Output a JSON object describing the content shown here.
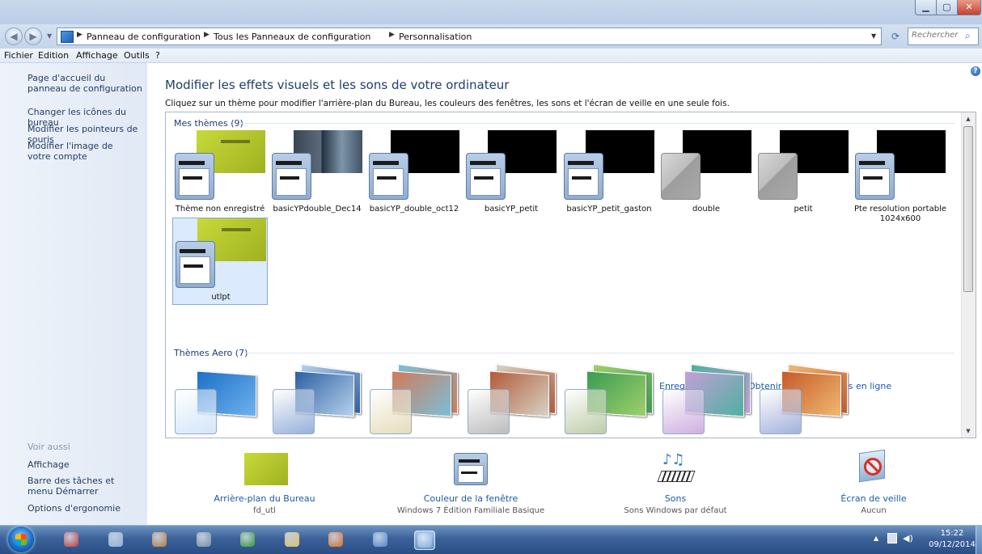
{
  "window": {
    "minimize_icon": "minimize-icon",
    "maximize_icon": "maximize-icon",
    "close_icon": "close-icon",
    "close_glyph": "✕"
  },
  "address": {
    "crumbs": [
      "Panneau de configuration",
      "Tous les Panneaux de configuration",
      "Personnalisation"
    ],
    "search_placeholder": "Rechercher"
  },
  "menu": [
    "Fichier",
    "Edition",
    "Affichage",
    "Outils",
    "?"
  ],
  "sidebar": {
    "links": [
      "Page d'accueil du panneau de configuration",
      "Changer les icônes du bureau",
      "Modifier les pointeurs de souris",
      "Modifier l'image de votre compte"
    ],
    "see_also_label": "Voir aussi",
    "see_also": [
      "Affichage",
      "Barre des tâches et menu Démarrer",
      "Options d'ergonomie"
    ]
  },
  "main": {
    "title": "Modifier les effets visuels et les sons de votre ordinateur",
    "subtitle": "Cliquez sur un thème pour modifier l'arrière-plan du Bureau, les couleurs des fenêtres, les sons et l'écran de veille en une seule fois.",
    "my_themes_header": "Mes thèmes (9)",
    "my_themes": [
      {
        "label": "Thème non enregistré",
        "thumb": "yellow",
        "window": "blue"
      },
      {
        "label": "basicYPdouble_Dec14",
        "thumb": "photo",
        "window": "blue"
      },
      {
        "label": "basicYP_double_oct12",
        "thumb": "black",
        "window": "blue"
      },
      {
        "label": "basicYP_petit",
        "thumb": "black",
        "window": "blue"
      },
      {
        "label": "basicYP_petit_gaston",
        "thumb": "black",
        "window": "blue"
      },
      {
        "label": "double",
        "thumb": "black",
        "window": "gray"
      },
      {
        "label": "petit",
        "thumb": "black",
        "window": "gray"
      },
      {
        "label": "Pte resolution portable 1024x600",
        "thumb": "black",
        "window": "blue"
      },
      {
        "label": "utlpt",
        "thumb": "yellow",
        "window": "blue",
        "selected": true
      }
    ],
    "save_theme_link": "Enregistrer le thème",
    "more_themes_link": "Obtenir plus de thèmes en ligne",
    "aero_header": "Thèmes Aero (7)",
    "aero_themes": [
      {
        "colors": [
          "#1d6fc8",
          "#6fb2ec"
        ],
        "window": "#cfe3f7"
      },
      {
        "colors": [
          "#2c5fa0",
          "#b6d2ee"
        ],
        "window": "#8ba7d6"
      },
      {
        "colors": [
          "#d27a58",
          "#79c0d8"
        ],
        "window": "#e4d9b4"
      },
      {
        "colors": [
          "#b25a38",
          "#d8d2c4"
        ],
        "window": "#b5b5b5"
      },
      {
        "colors": [
          "#3a9b52",
          "#9fd06b"
        ],
        "window": "#b7c7a0"
      },
      {
        "colors": [
          "#c4a0d8",
          "#4db0a0"
        ],
        "window": "#c9a6dd"
      },
      {
        "colors": [
          "#c65a2a",
          "#f0b870"
        ],
        "window": "#9aa8d6"
      }
    ]
  },
  "bottom": [
    {
      "link": "Arrière-plan du Bureau",
      "sub": "fd_utl",
      "icon": "desktop-background-icon"
    },
    {
      "link": "Couleur de la fenêtre",
      "sub": "Windows 7 Édition Familiale Basique",
      "icon": "window-color-icon"
    },
    {
      "link": "Sons",
      "sub": "Sons Windows par défaut",
      "icon": "sounds-icon"
    },
    {
      "link": "Écran de veille",
      "sub": "Aucun",
      "icon": "screensaver-icon"
    }
  ],
  "taskbar": {
    "icons": [
      {
        "name": "snipping-tool-icon",
        "color": "#c83b3b"
      },
      {
        "name": "notepad-icon",
        "color": "#8fb1d8"
      },
      {
        "name": "games-icon",
        "color": "#b87c3a"
      },
      {
        "name": "calculator-icon",
        "color": "#7a8fa6"
      },
      {
        "name": "xbox-icon",
        "color": "#2f9a2f"
      },
      {
        "name": "explorer-icon",
        "color": "#e8c35a"
      },
      {
        "name": "firefox-icon",
        "color": "#e36b1c"
      },
      {
        "name": "media-icon",
        "color": "#4f8ad1"
      },
      {
        "name": "control-panel-icon",
        "color": "#7fb0e6"
      }
    ],
    "time": "15:22",
    "date": "09/12/2014"
  }
}
